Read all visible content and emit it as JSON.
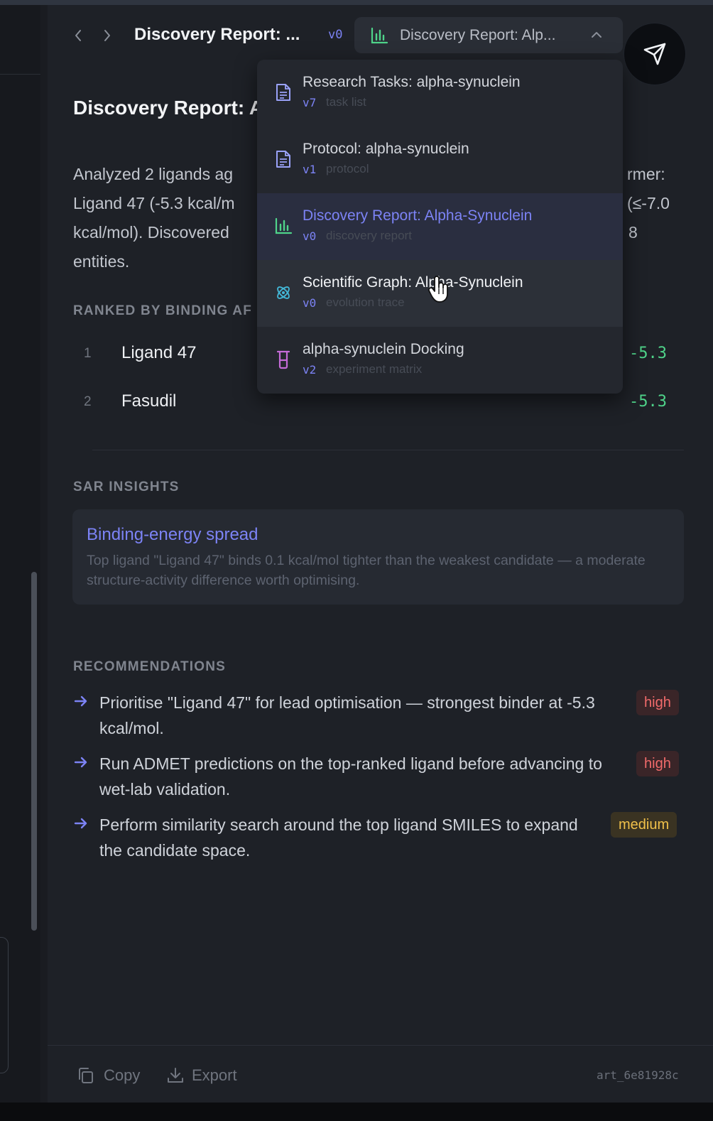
{
  "header": {
    "back_icon": "chevron-left-icon",
    "forward_icon": "chevron-right-icon",
    "title": "Discovery Report: ...",
    "version": "v0",
    "switcher_label": "Discovery Report: Alp...",
    "switcher_icon": "bar-chart-icon",
    "fab_icon": "paper-plane-icon"
  },
  "report": {
    "title": "Discovery Report: A",
    "summary_lines": [
      "Analyzed 2 ligands ag",
      "Ligand 47 (-5.3 kcal/m",
      "kcal/mol). Discovered",
      "entities."
    ],
    "summary_right": [
      "rmer:",
      "(≤-7.0",
      "8"
    ],
    "ranked_heading": "RANKED BY BINDING AF",
    "ranked": [
      {
        "rank": "1",
        "name": "Ligand 47",
        "score": "-5.3"
      },
      {
        "rank": "2",
        "name": "Fasudil",
        "score": "-5.3"
      }
    ],
    "sar_heading": "SAR INSIGHTS",
    "insight": {
      "title": "Binding-energy spread",
      "text": "Top ligand \"Ligand 47\" binds 0.1 kcal/mol tighter than the weakest candidate — a moderate structure-activity difference worth optimising."
    },
    "rec_heading": "RECOMMENDATIONS",
    "recommendations": [
      {
        "text": "Prioritise \"Ligand 47\" for lead optimisation — strongest binder at -5.3 kcal/mol.",
        "priority": "high"
      },
      {
        "text": "Run ADMET predictions on the top-ranked ligand before advancing to wet-lab validation.",
        "priority": "high"
      },
      {
        "text": "Perform similarity search around the top ligand SMILES to expand the candidate space.",
        "priority": "medium"
      }
    ]
  },
  "footer": {
    "copy_label": "Copy",
    "export_label": "Export",
    "artifact_id": "art_6e81928c"
  },
  "dropdown": {
    "items": [
      {
        "name": "Research Tasks: alpha-synuclein",
        "version": "v7",
        "kind": "task list",
        "icon": "document-icon",
        "state": "normal"
      },
      {
        "name": "Protocol: alpha-synuclein",
        "version": "v1",
        "kind": "protocol",
        "icon": "document-icon",
        "state": "normal"
      },
      {
        "name": "Discovery Report: Alpha-Synuclein",
        "version": "v0",
        "kind": "discovery report",
        "icon": "bar-chart-icon",
        "state": "selected"
      },
      {
        "name": "Scientific Graph: Alpha-Synuclein",
        "version": "v0",
        "kind": "evolution trace",
        "icon": "atom-icon",
        "state": "hovered"
      },
      {
        "name": "alpha-synuclein Docking",
        "version": "v2",
        "kind": "experiment matrix",
        "icon": "flask-icon",
        "state": "normal"
      }
    ]
  },
  "colors": {
    "accent": "#7c83f5",
    "score_green": "#4fd48a",
    "high": "#f26b6b",
    "medium": "#f0c04a",
    "background": "#1e2127"
  }
}
